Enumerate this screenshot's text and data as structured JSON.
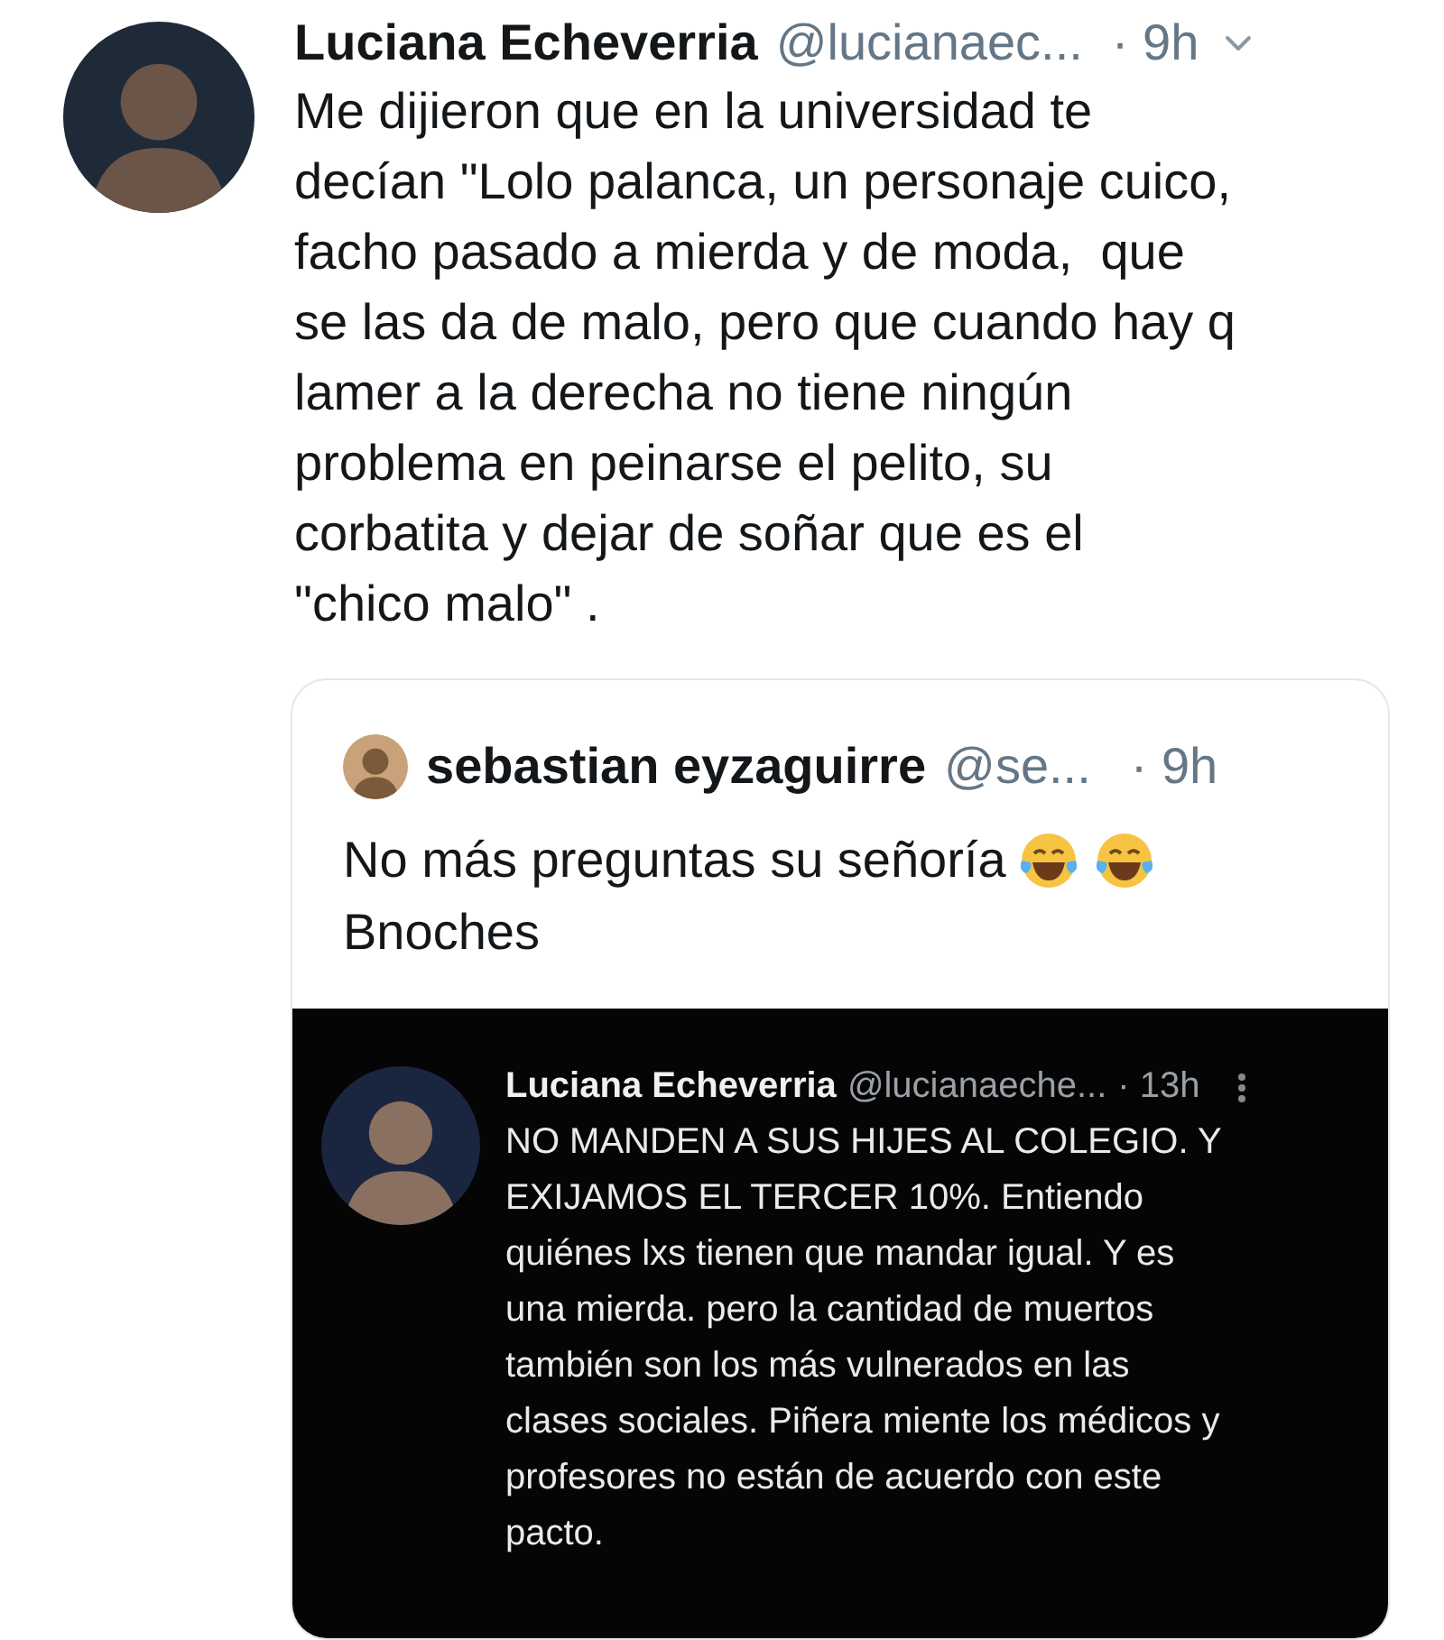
{
  "tweet": {
    "author_name": "Luciana Echeverria",
    "handle": "@lucianaec...",
    "time": "· 9h",
    "text": "Me dijieron que en la universidad te\ndecían \"Lolo palanca, un personaje cuico,\nfacho pasado a mierda y de moda,  que\nse las da de malo, pero que cuando hay q\nlamer a la derecha no tiene ningún\nproblema en peinarse el pelito, su\ncorbatita y dejar de soñar que es el\n\"chico malo\" ."
  },
  "quoted": {
    "author_name": "sebastian eyzaguirre",
    "handle": "@se...",
    "time": "· 9h",
    "text": "No más preguntas su señoría",
    "emojis": [
      {
        "kind": "laughing"
      },
      {
        "kind": "laughing"
      }
    ],
    "text_after": "Bnoches",
    "embedded_tweet": {
      "author_name": "Luciana Echeverria",
      "handle": "@lucianaeche...",
      "time": "· 13h",
      "text": "NO MANDEN A SUS HIJES AL COLEGIO. Y\nEXIJAMOS EL TERCER 10%. Entiendo\nquiénes lxs tienen que mandar igual. Y es\nuna mierda. pero la cantidad de muertos\ntambién son los más vulnerados en las\nclases sociales. Piñera miente los médicos y\nprofesores no están de acuerdo con este\npacto."
    }
  }
}
